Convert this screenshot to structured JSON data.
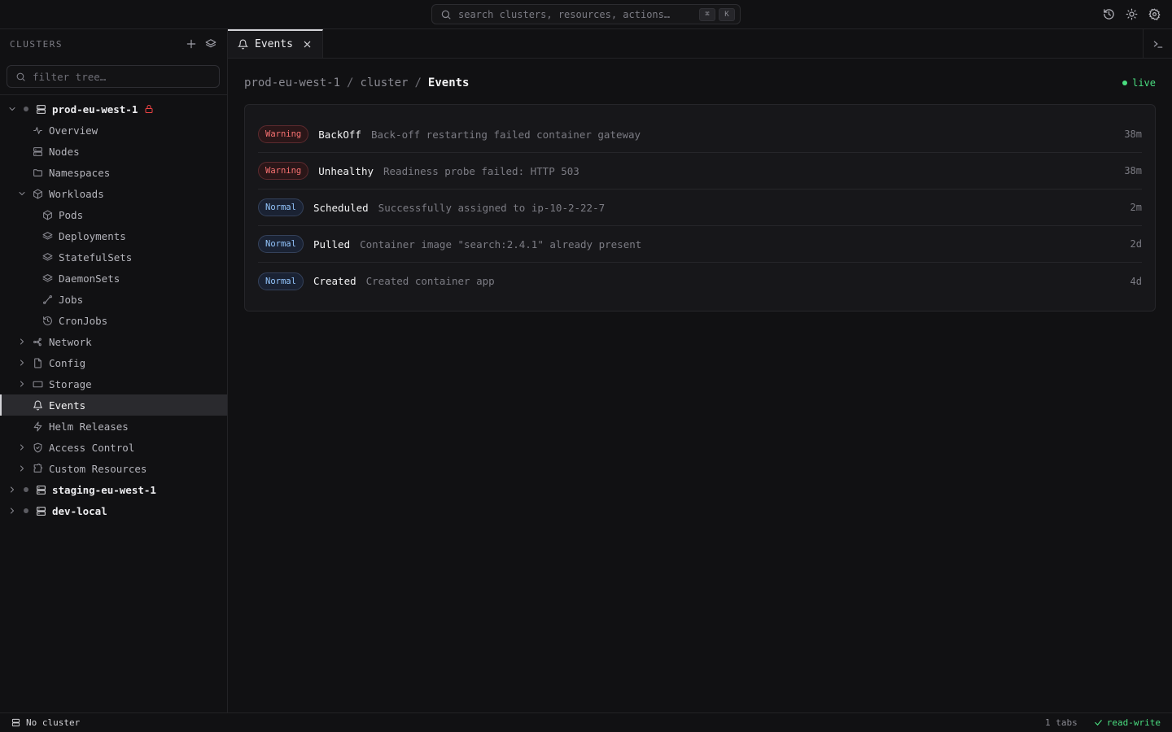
{
  "search": {
    "placeholder": "search clusters, resources, actions…",
    "kbd": [
      "⌘",
      "K"
    ]
  },
  "sidebar": {
    "title": "CLUSTERS",
    "filter_placeholder": "filter tree…",
    "tree": [
      {
        "label": "prod-eu-west-1",
        "type": "cluster",
        "expanded": true,
        "locked": true
      },
      {
        "label": "Overview",
        "icon": "activity-icon"
      },
      {
        "label": "Nodes",
        "icon": "server-icon"
      },
      {
        "label": "Namespaces",
        "icon": "folder-icon"
      },
      {
        "label": "Workloads",
        "icon": "box-icon",
        "expanded": true
      },
      {
        "label": "Pods",
        "icon": "box-icon"
      },
      {
        "label": "Deployments",
        "icon": "layers-icon"
      },
      {
        "label": "StatefulSets",
        "icon": "layers-icon"
      },
      {
        "label": "DaemonSets",
        "icon": "layers-icon"
      },
      {
        "label": "Jobs",
        "icon": "workflow-icon"
      },
      {
        "label": "CronJobs",
        "icon": "history-icon"
      },
      {
        "label": "Network",
        "icon": "network-icon",
        "expanded": false
      },
      {
        "label": "Config",
        "icon": "file-icon",
        "expanded": false
      },
      {
        "label": "Storage",
        "icon": "storage-icon",
        "expanded": false
      },
      {
        "label": "Events",
        "icon": "bell-icon",
        "active": true
      },
      {
        "label": "Helm Releases",
        "icon": "zap-icon"
      },
      {
        "label": "Access Control",
        "icon": "shield-icon",
        "expanded": false
      },
      {
        "label": "Custom Resources",
        "icon": "puzzle-icon",
        "expanded": false
      },
      {
        "label": "staging-eu-west-1",
        "type": "cluster",
        "expanded": false
      },
      {
        "label": "dev-local",
        "type": "cluster",
        "expanded": false
      }
    ]
  },
  "tabs": [
    {
      "label": "Events"
    }
  ],
  "breadcrumb": {
    "cluster": "prod-eu-west-1",
    "scope": "cluster",
    "current": "Events",
    "sep": "/"
  },
  "live_label": "live",
  "events": [
    {
      "type": "Warning",
      "reason": "BackOff",
      "message": "Back-off restarting failed container gateway",
      "age": "38m"
    },
    {
      "type": "Warning",
      "reason": "Unhealthy",
      "message": "Readiness probe failed: HTTP 503",
      "age": "38m"
    },
    {
      "type": "Normal",
      "reason": "Scheduled",
      "message": "Successfully assigned to ip-10-2-22-7",
      "age": "2m"
    },
    {
      "type": "Normal",
      "reason": "Pulled",
      "message": "Container image \"search:2.4.1\" already present",
      "age": "2d"
    },
    {
      "type": "Normal",
      "reason": "Created",
      "message": "Created container app",
      "age": "4d"
    }
  ],
  "statusbar": {
    "cluster": "No cluster",
    "tabs": "1 tabs",
    "mode": "read-write"
  },
  "colors": {
    "background": "#111113",
    "accent_green": "#4ade80",
    "warning": "#f87171",
    "normal": "#93c5fd",
    "lock": "#ef4444"
  }
}
